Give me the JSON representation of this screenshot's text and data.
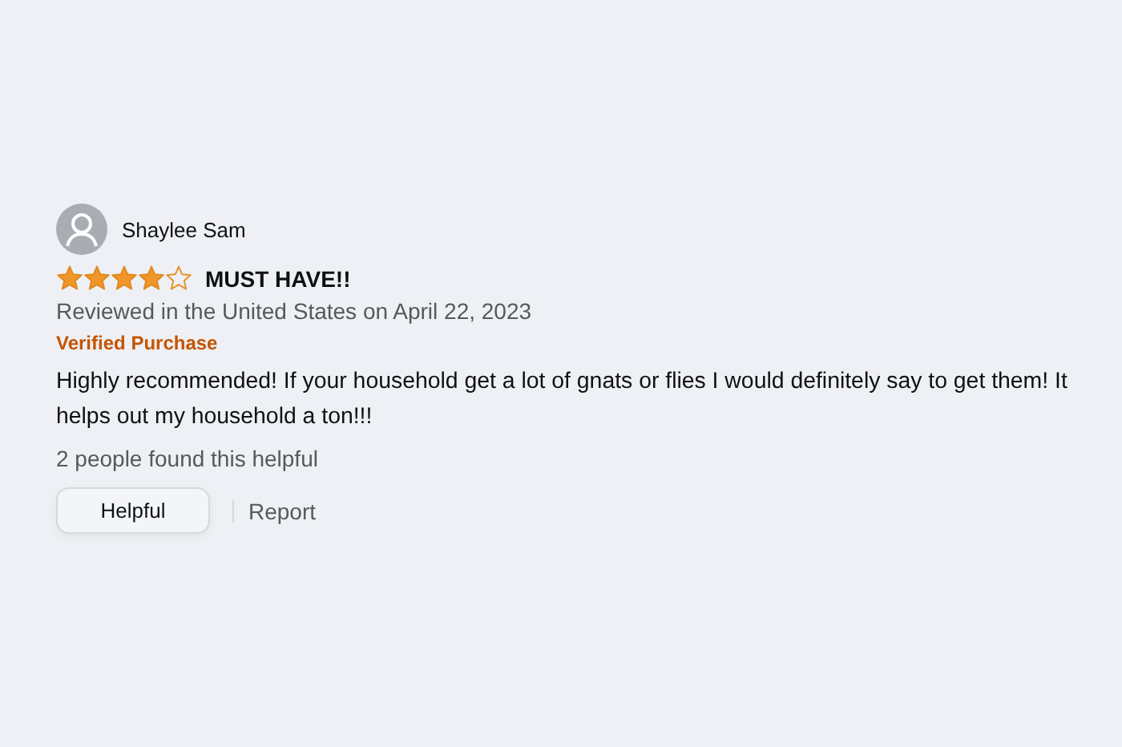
{
  "review": {
    "author": "Shaylee Sam",
    "stars": 4,
    "title": "MUST HAVE!!",
    "date": "Reviewed in the United States on April 22, 2023",
    "badge": "Verified Purchase",
    "body": "Highly recommended! If your household get a lot of gnats or flies I would definitely say to get them! It helps out my household a ton!!!",
    "helpful_count": "2 people found this helpful",
    "buttons": [
      "Helpful"
    ],
    "link": "Report"
  }
}
